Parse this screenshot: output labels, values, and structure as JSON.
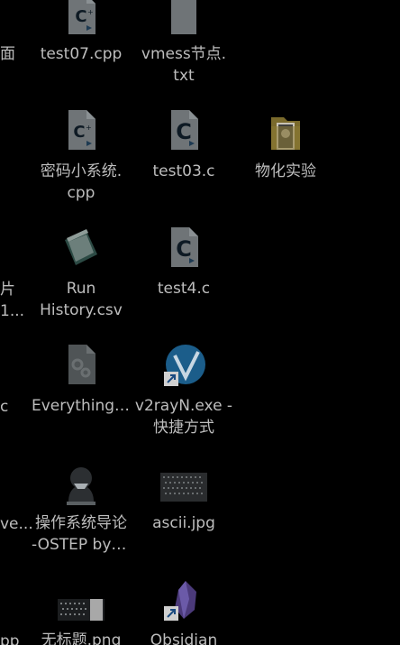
{
  "desktop": {
    "left_edge_labels": [
      {
        "name": "left-edge-label-1",
        "text": "面"
      },
      {
        "name": "left-edge-label-2",
        "text": "片"
      },
      {
        "name": "left-edge-label-3",
        "text": "1..."
      },
      {
        "name": "left-edge-label-4",
        "text": "c"
      },
      {
        "name": "left-edge-label-5",
        "text": "ve..."
      },
      {
        "name": "left-edge-label-6",
        "text": "pp"
      }
    ],
    "icons": [
      {
        "name": "file-test07-cpp",
        "icon": "cpp-file-icon",
        "line1": "test07.cpp",
        "line2": ""
      },
      {
        "name": "file-vmess-txt",
        "icon": "text-file-icon",
        "line1": "vmess节点.",
        "line2": "txt"
      },
      {
        "name": "file-mima-cpp",
        "icon": "cpp-file-icon",
        "line1": "密码小系统.",
        "line2": "cpp"
      },
      {
        "name": "file-test03-c",
        "icon": "c-file-icon",
        "line1": "test03.c",
        "line2": ""
      },
      {
        "name": "folder-wuhua",
        "icon": "folder-icon",
        "line1": "物化实验",
        "line2": ""
      },
      {
        "name": "file-run-history-csv",
        "icon": "csv-file-icon",
        "line1": "Run",
        "line2": "History.csv"
      },
      {
        "name": "file-test4-c",
        "icon": "c-file-icon",
        "line1": "test4.c",
        "line2": ""
      },
      {
        "name": "file-everything",
        "icon": "settings-file-icon",
        "line1": "Everything....",
        "line2": ""
      },
      {
        "name": "shortcut-v2rayn",
        "icon": "v2rayn-icon",
        "line1": "v2rayN.exe -",
        "line2": "快捷方式"
      },
      {
        "name": "file-ostep",
        "icon": "hacker-avatar-icon",
        "line1": "操作系统导论",
        "line2": "-OSTEP by ..."
      },
      {
        "name": "file-ascii-jpg",
        "icon": "image-thumbnail-icon",
        "line1": "ascii.jpg",
        "line2": ""
      },
      {
        "name": "file-untitled-png",
        "icon": "image-thumbnail-icon",
        "line1": "无标题.png",
        "line2": ""
      },
      {
        "name": "shortcut-obsidian",
        "icon": "obsidian-icon",
        "line1": "Obsidian",
        "line2": ""
      }
    ]
  }
}
